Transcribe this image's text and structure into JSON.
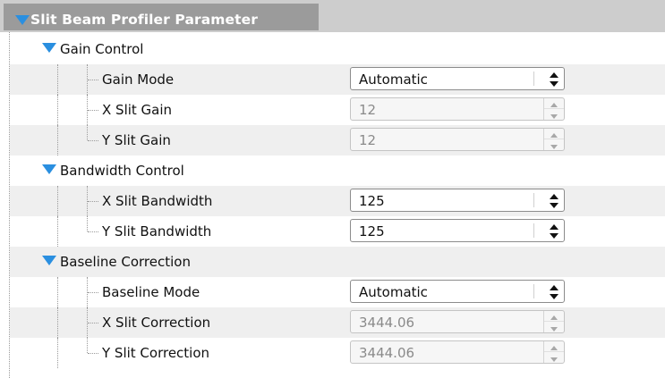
{
  "header": {
    "title": "Slit Beam Profiler Parameter"
  },
  "groups": [
    {
      "label": "Gain Control",
      "items": [
        {
          "label": "Gain Mode",
          "value": "Automatic",
          "control": "dropdown",
          "enabled": true
        },
        {
          "label": "X Slit Gain",
          "value": "12",
          "control": "spinbox",
          "enabled": false
        },
        {
          "label": "Y Slit Gain",
          "value": "12",
          "control": "spinbox",
          "enabled": false
        }
      ]
    },
    {
      "label": "Bandwidth Control",
      "items": [
        {
          "label": "X Slit Bandwidth",
          "value": "125",
          "control": "dropdown",
          "enabled": true
        },
        {
          "label": "Y Slit Bandwidth",
          "value": "125",
          "control": "dropdown",
          "enabled": true
        }
      ]
    },
    {
      "label": "Baseline Correction",
      "items": [
        {
          "label": "Baseline Mode",
          "value": "Automatic",
          "control": "dropdown",
          "enabled": true
        },
        {
          "label": "X Slit Correction",
          "value": "3444.06",
          "control": "spinbox",
          "enabled": false
        },
        {
          "label": "Y Slit Correction",
          "value": "3444.06",
          "control": "spinbox",
          "enabled": false
        }
      ]
    }
  ],
  "colors": {
    "header_bg": "#cdcdcd",
    "header_title_bg": "#9b9b9b",
    "triangle": "#2a8fe0",
    "row_shade": "#efefef"
  }
}
